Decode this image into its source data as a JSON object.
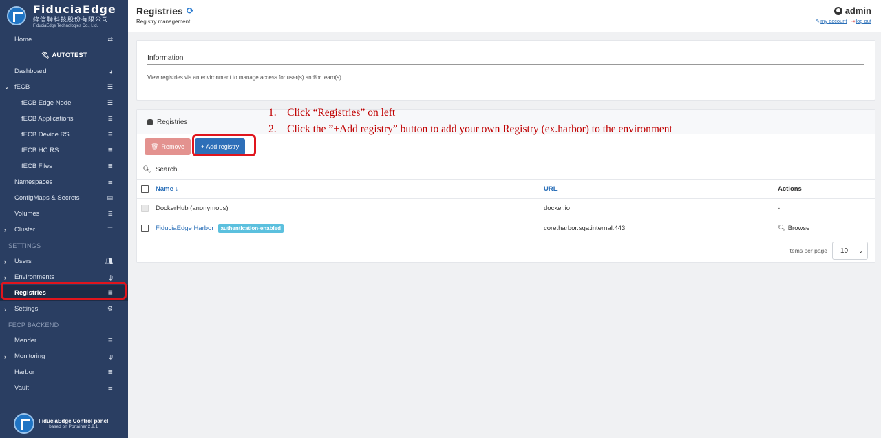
{
  "brand": {
    "name": "FiduciaEdge",
    "name_cn": "緯信聯科技股份有限公司",
    "name_en": "FiduciaEdge Technologies Co., Ltd."
  },
  "sidebar": {
    "home": "Home",
    "environment": "AUTOTEST",
    "items": [
      {
        "label": "Dashboard"
      },
      {
        "label": "fECB"
      },
      {
        "label": "fECB Edge Node"
      },
      {
        "label": "fECB Applications"
      },
      {
        "label": "fECB Device RS"
      },
      {
        "label": "fECB HC RS"
      },
      {
        "label": "fECB Files"
      },
      {
        "label": "Namespaces"
      },
      {
        "label": "ConfigMaps & Secrets"
      },
      {
        "label": "Volumes"
      },
      {
        "label": "Cluster"
      }
    ],
    "settings_section": "SETTINGS",
    "settings_items": [
      {
        "label": "Users"
      },
      {
        "label": "Environments"
      },
      {
        "label": "Registries"
      },
      {
        "label": "Settings"
      }
    ],
    "backend_section": "FECP BACKEND",
    "backend_items": [
      {
        "label": "Mender"
      },
      {
        "label": "Monitoring"
      },
      {
        "label": "Harbor"
      },
      {
        "label": "Vault"
      }
    ],
    "footer_title": "FiduciaEdge Control panel",
    "footer_sub": "based on Portainer 2.9.1"
  },
  "header": {
    "title": "Registries",
    "subtitle": "Registry management",
    "user": "admin",
    "my_account": "my account",
    "log_out": "log out"
  },
  "info": {
    "title": "Information",
    "text": "View registries via an environment to manage access for user(s) and/or team(s)"
  },
  "registries": {
    "title": "Registries",
    "remove_label": "Remove",
    "add_label": "+ Add registry",
    "search_placeholder": "Search...",
    "columns": {
      "name": "Name",
      "url": "URL",
      "actions": "Actions"
    },
    "rows": [
      {
        "name": "DockerHub (anonymous)",
        "url": "docker.io",
        "action": "-"
      },
      {
        "name": "FiduciaEdge Harbor",
        "badge": "authentication-enabled",
        "url": "core.harbor.sqa.internal:443",
        "action": "Browse"
      }
    ],
    "items_per_page_label": "Items per page",
    "items_per_page_value": "10"
  },
  "annotations": {
    "step1": "1.    Click “Registries” on left",
    "step2": "2.    Click the ”+Add registry” button to add your own Registry (ex.harbor) to the environment"
  },
  "colors": {
    "sidebar_bg": "#2a3e62",
    "primary": "#2e6fb8",
    "danger_light": "#e3928f",
    "badge": "#5bc0de",
    "annotation": "#c00000"
  }
}
